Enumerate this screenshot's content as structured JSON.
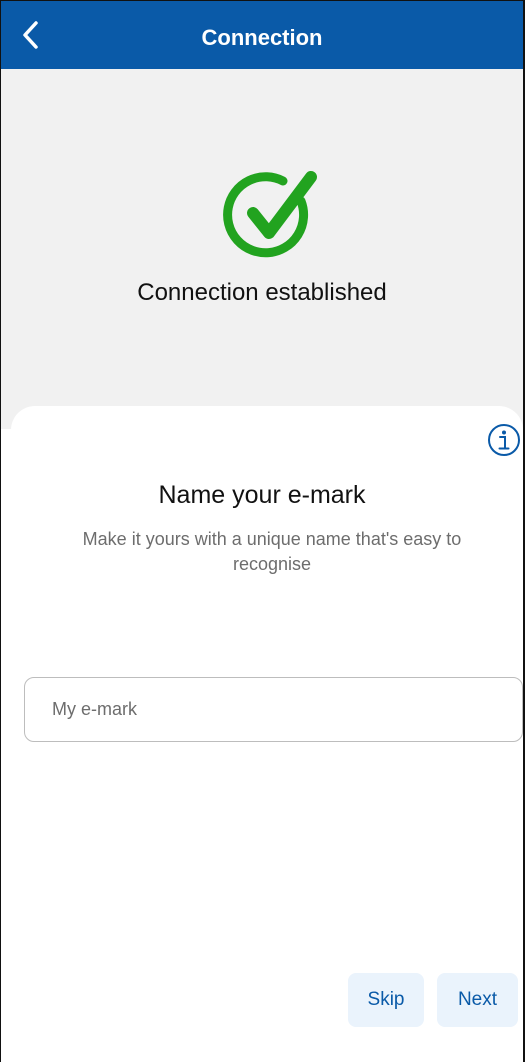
{
  "header": {
    "title": "Connection",
    "back_icon": "chevron-left-icon"
  },
  "status": {
    "text": "Connection established",
    "icon": "check-circle-icon",
    "color": "#22a31f"
  },
  "sheet": {
    "heading": "Name your e-mark",
    "subtitle": "Make it yours with a unique name that's easy to recognise",
    "info_icon": "info-icon",
    "input": {
      "placeholder": "My e-mark",
      "value": ""
    }
  },
  "actions": {
    "skip_label": "Skip",
    "next_label": "Next"
  },
  "colors": {
    "brand": "#0a5aa8",
    "success": "#22a31f",
    "button_bg": "#eaf3fc"
  }
}
